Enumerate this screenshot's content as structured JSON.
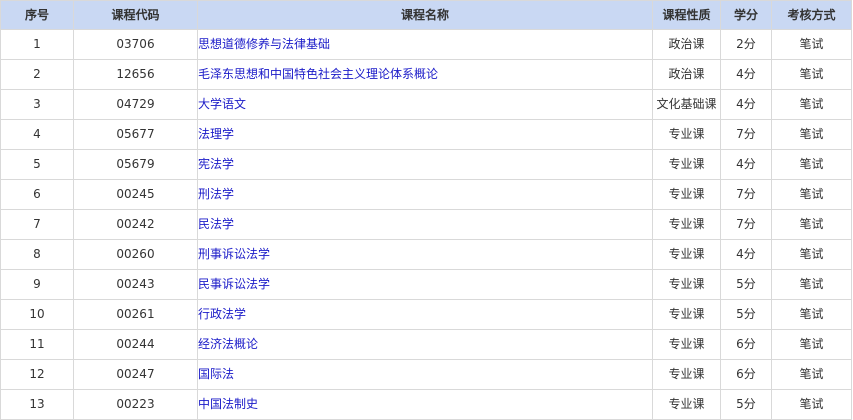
{
  "headers": {
    "seq": "序号",
    "code": "课程代码",
    "name": "课程名称",
    "type": "课程性质",
    "credit": "学分",
    "exam": "考核方式"
  },
  "rows": [
    {
      "seq": "1",
      "code": "03706",
      "name": "思想道德修养与法律基础",
      "type": "政治课",
      "credit": "2分",
      "exam": "笔试"
    },
    {
      "seq": "2",
      "code": "12656",
      "name": "毛泽东思想和中国特色社会主义理论体系概论",
      "type": "政治课",
      "credit": "4分",
      "exam": "笔试"
    },
    {
      "seq": "3",
      "code": "04729",
      "name": "大学语文",
      "type": "文化基础课",
      "credit": "4分",
      "exam": "笔试"
    },
    {
      "seq": "4",
      "code": "05677",
      "name": "法理学",
      "type": "专业课",
      "credit": "7分",
      "exam": "笔试"
    },
    {
      "seq": "5",
      "code": "05679",
      "name": "宪法学",
      "type": "专业课",
      "credit": "4分",
      "exam": "笔试"
    },
    {
      "seq": "6",
      "code": "00245",
      "name": "刑法学",
      "type": "专业课",
      "credit": "7分",
      "exam": "笔试"
    },
    {
      "seq": "7",
      "code": "00242",
      "name": "民法学",
      "type": "专业课",
      "credit": "7分",
      "exam": "笔试"
    },
    {
      "seq": "8",
      "code": "00260",
      "name": "刑事诉讼法学",
      "type": "专业课",
      "credit": "4分",
      "exam": "笔试"
    },
    {
      "seq": "9",
      "code": "00243",
      "name": "民事诉讼法学",
      "type": "专业课",
      "credit": "5分",
      "exam": "笔试"
    },
    {
      "seq": "10",
      "code": "00261",
      "name": "行政法学",
      "type": "专业课",
      "credit": "5分",
      "exam": "笔试"
    },
    {
      "seq": "11",
      "code": "00244",
      "name": "经济法概论",
      "type": "专业课",
      "credit": "6分",
      "exam": "笔试"
    },
    {
      "seq": "12",
      "code": "00247",
      "name": "国际法",
      "type": "专业课",
      "credit": "6分",
      "exam": "笔试"
    },
    {
      "seq": "13",
      "code": "00223",
      "name": "中国法制史",
      "type": "专业课",
      "credit": "5分",
      "exam": "笔试"
    }
  ]
}
